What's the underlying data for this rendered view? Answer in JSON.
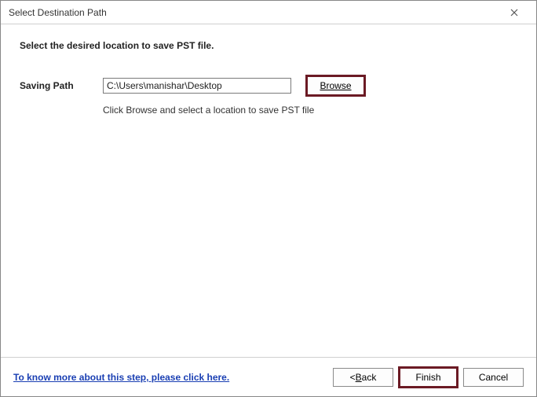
{
  "window": {
    "title": "Select Destination Path"
  },
  "main": {
    "instruction": "Select the desired location to save PST file.",
    "saving_path_label": "Saving Path",
    "saving_path_value": "C:\\Users\\manishar\\Desktop",
    "browse_label": "Browse",
    "hint": "Click Browse and select a location to save PST file"
  },
  "footer": {
    "help_link": "To know more about this step, please click here.",
    "back_prefix": "< ",
    "back_mnemonic": "B",
    "back_rest": "ack",
    "finish_label": "Finish",
    "cancel_label": "Cancel"
  }
}
